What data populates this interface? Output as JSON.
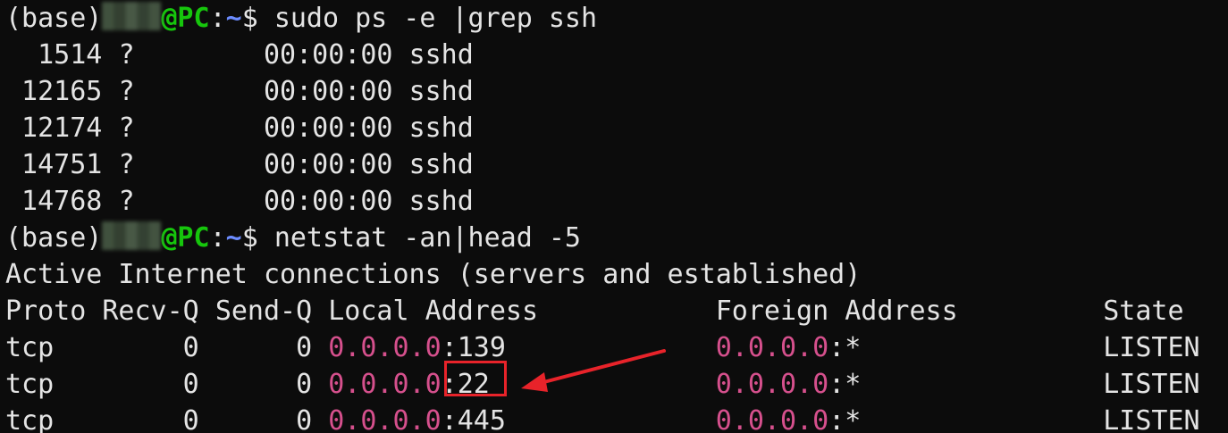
{
  "prompt": {
    "env": "(base)",
    "host": "@PC",
    "colon": ":",
    "path": "~",
    "symbol": "$"
  },
  "commands": {
    "cmd1": "sudo ps -e |grep ssh",
    "cmd2": "netstat -an|head -5"
  },
  "ps_rows": [
    {
      "pid": "1514",
      "tty": "?",
      "time": "00:00:00",
      "cmd": "sshd"
    },
    {
      "pid": "12165",
      "tty": "?",
      "time": "00:00:00",
      "cmd": "sshd"
    },
    {
      "pid": "12174",
      "tty": "?",
      "time": "00:00:00",
      "cmd": "sshd"
    },
    {
      "pid": "14751",
      "tty": "?",
      "time": "00:00:00",
      "cmd": "sshd"
    },
    {
      "pid": "14768",
      "tty": "?",
      "time": "00:00:00",
      "cmd": "sshd"
    }
  ],
  "netstat": {
    "title": "Active Internet connections (servers and established)",
    "headers": {
      "proto": "Proto",
      "recvq": "Recv-Q",
      "sendq": "Send-Q",
      "local": "Local Address",
      "foreign": "Foreign Address",
      "state": "State"
    },
    "rows": [
      {
        "proto": "tcp",
        "recvq": "0",
        "sendq": "0",
        "local_ip": "0.0.0.0",
        "local_port": "139",
        "foreign_ip": "0.0.0.0",
        "foreign_port": "*",
        "state": "LISTEN"
      },
      {
        "proto": "tcp",
        "recvq": "0",
        "sendq": "0",
        "local_ip": "0.0.0.0",
        "local_port": "22",
        "foreign_ip": "0.0.0.0",
        "foreign_port": "*",
        "state": "LISTEN"
      },
      {
        "proto": "tcp",
        "recvq": "0",
        "sendq": "0",
        "local_ip": "0.0.0.0",
        "local_port": "445",
        "foreign_ip": "0.0.0.0",
        "foreign_port": "*",
        "state": "LISTEN"
      }
    ]
  },
  "colors": {
    "background": "#0c0c0c",
    "text": "#e4e4e4",
    "prompt_green": "#16c60c",
    "prompt_path": "#6c8cff",
    "ip_pink": "#d6508d",
    "annotation_red": "#e8232a"
  }
}
